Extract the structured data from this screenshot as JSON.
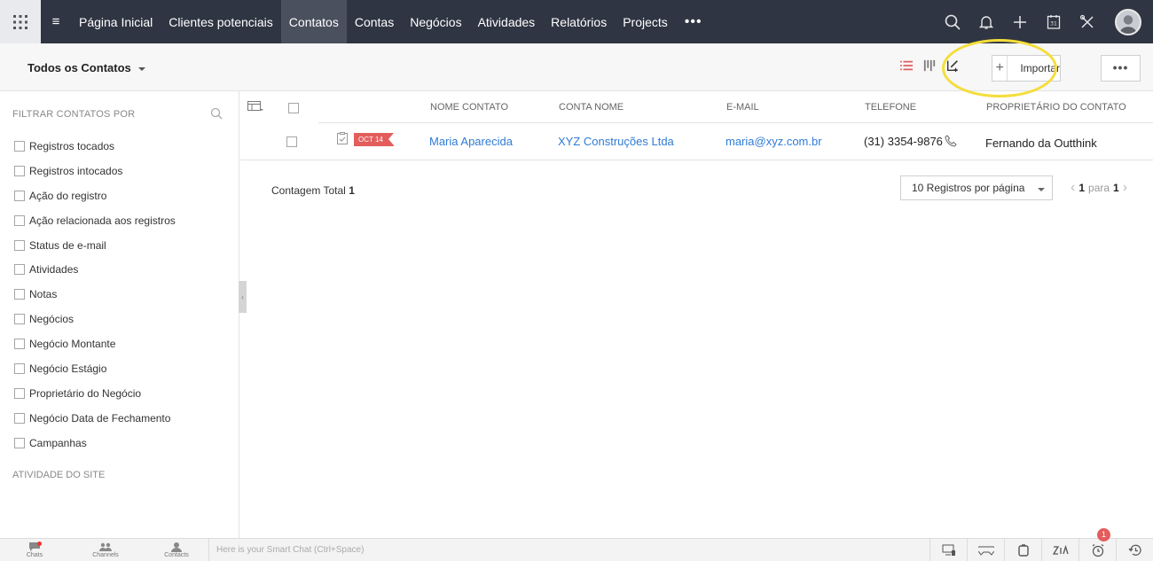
{
  "nav": {
    "tabs": [
      "Página Inicial",
      "Clientes potenciais",
      "Contatos",
      "Contas",
      "Negócios",
      "Atividades",
      "Relatórios",
      "Projects"
    ],
    "active_tab": "Contatos",
    "more": "•••",
    "calendar_day": "31"
  },
  "subheader": {
    "view_name": "Todos os Contatos",
    "import_label": "Importar",
    "plus": "+",
    "more": "•••"
  },
  "sidebar": {
    "title": "FILTRAR CONTATOS POR",
    "filters": [
      "Registros tocados",
      "Registros intocados",
      "Ação do registro",
      "Ação relacionada aos registros",
      "Status de e-mail",
      "Atividades",
      "Notas",
      "Negócios",
      "Negócio Montante",
      "Negócio Estágio",
      "Proprietário do Negócio",
      "Negócio Data de Fechamento",
      "Campanhas"
    ],
    "section2": "ATIVIDADE DO SITE"
  },
  "table": {
    "headers": {
      "name": "NOME CONTATO",
      "account": "CONTA NOME",
      "email": "E-MAIL",
      "phone": "TELEFONE",
      "owner": "PROPRIETÁRIO DO CONTATO"
    },
    "rows": [
      {
        "tag": "OCT 14",
        "name": "Maria Aparecida",
        "account": "XYZ Construções Ltda",
        "email": "maria@xyz.com.br",
        "phone": "(31) 3354-9876",
        "owner": "Fernando da Outthink"
      }
    ]
  },
  "footer": {
    "count_label": "Contagem Total",
    "count_value": "1",
    "per_page": "10 Registros por página",
    "page_current": "1",
    "page_sep": "para",
    "page_total": "1"
  },
  "bottombar": {
    "chats": "Chats",
    "channels": "Channels",
    "contacts": "Contacts",
    "smart_chat_placeholder": "Here is your Smart Chat (Ctrl+Space)",
    "alarm_badge": "1"
  }
}
